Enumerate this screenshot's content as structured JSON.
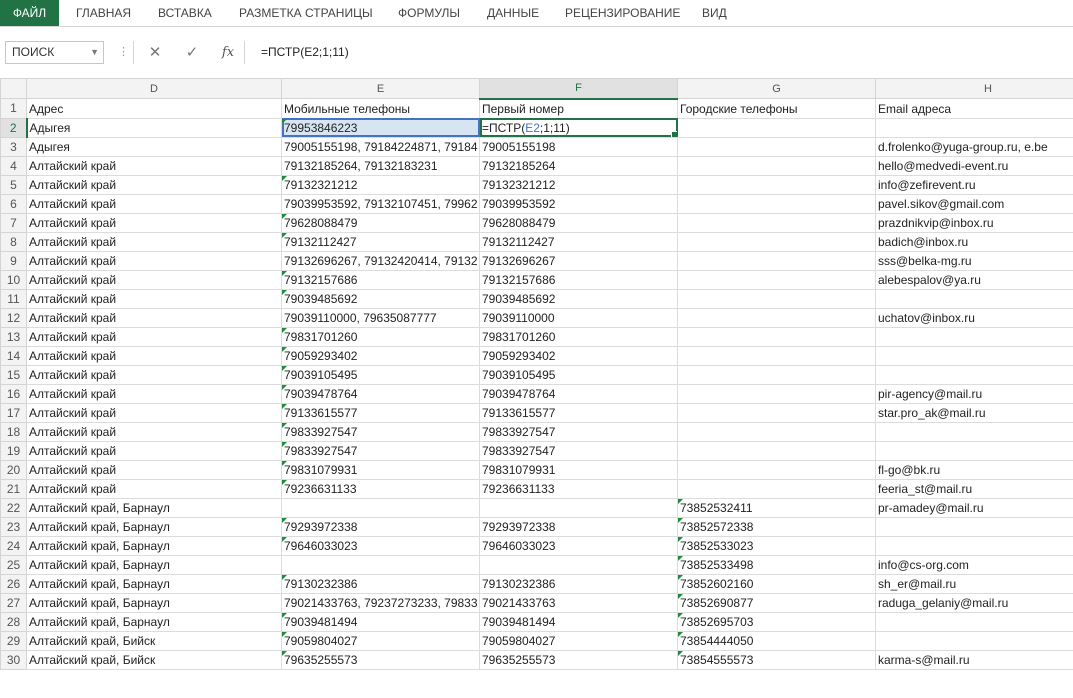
{
  "ribbon": {
    "tabs": [
      "ФАЙЛ",
      "ГЛАВНАЯ",
      "ВСТАВКА",
      "РАЗМЕТКА СТРАНИЦЫ",
      "ФОРМУЛЫ",
      "ДАННЫЕ",
      "РЕЦЕНЗИРОВАНИЕ",
      "ВИД"
    ]
  },
  "formula_bar": {
    "name_box": "ПОИСК",
    "cancel_icon": "✕",
    "enter_icon": "✓",
    "function_icon": "fx",
    "formula": "=ПСТР(E2;1;11)"
  },
  "grid": {
    "columns": [
      "D",
      "E",
      "F",
      "G",
      "H"
    ],
    "selected_column": "F",
    "selected_row": 2,
    "active_cell": {
      "prefix": "=ПСТР(",
      "ref": "E2",
      "suffix": ";1;11)"
    },
    "rows": [
      {
        "n": "1",
        "d": "Адрес",
        "e": "Мобильные телефоны",
        "f": "Первый номер",
        "g": "Городские телефоны",
        "h": "Email адреса"
      },
      {
        "n": "2",
        "d": "Адыгея",
        "e": "79953846223",
        "f": "",
        "g": "",
        "h": ""
      },
      {
        "n": "3",
        "d": "Адыгея",
        "e": "79005155198, 79184224871, 79184",
        "f": "79005155198",
        "g": "",
        "h": "d.frolenko@yuga-group.ru, e.be"
      },
      {
        "n": "4",
        "d": "Алтайский край",
        "e": "79132185264, 79132183231",
        "f": "79132185264",
        "g": "",
        "h": "hello@medvedi-event.ru"
      },
      {
        "n": "5",
        "d": "Алтайский край",
        "e": "79132321212",
        "f": "79132321212",
        "g": "",
        "h": "info@zefirevent.ru"
      },
      {
        "n": "6",
        "d": "Алтайский край",
        "e": "79039953592, 79132107451, 79962",
        "f": "79039953592",
        "g": "",
        "h": "pavel.sikov@gmail.com"
      },
      {
        "n": "7",
        "d": "Алтайский край",
        "e": "79628088479",
        "f": "79628088479",
        "g": "",
        "h": "prazdnikvip@inbox.ru"
      },
      {
        "n": "8",
        "d": "Алтайский край",
        "e": "79132112427",
        "f": "79132112427",
        "g": "",
        "h": "badich@inbox.ru"
      },
      {
        "n": "9",
        "d": "Алтайский край",
        "e": "79132696267, 79132420414, 79132",
        "f": "79132696267",
        "g": "",
        "h": "sss@belka-mg.ru"
      },
      {
        "n": "10",
        "d": "Алтайский край",
        "e": "79132157686",
        "f": "79132157686",
        "g": "",
        "h": "alebespalov@ya.ru"
      },
      {
        "n": "11",
        "d": "Алтайский край",
        "e": "79039485692",
        "f": "79039485692",
        "g": "",
        "h": ""
      },
      {
        "n": "12",
        "d": "Алтайский край",
        "e": "79039110000, 79635087777",
        "f": "79039110000",
        "g": "",
        "h": "uchatov@inbox.ru"
      },
      {
        "n": "13",
        "d": "Алтайский край",
        "e": "79831701260",
        "f": "79831701260",
        "g": "",
        "h": ""
      },
      {
        "n": "14",
        "d": "Алтайский край",
        "e": "79059293402",
        "f": "79059293402",
        "g": "",
        "h": ""
      },
      {
        "n": "15",
        "d": "Алтайский край",
        "e": "79039105495",
        "f": "79039105495",
        "g": "",
        "h": ""
      },
      {
        "n": "16",
        "d": "Алтайский край",
        "e": "79039478764",
        "f": "79039478764",
        "g": "",
        "h": "pir-agency@mail.ru"
      },
      {
        "n": "17",
        "d": "Алтайский край",
        "e": "79133615577",
        "f": "79133615577",
        "g": "",
        "h": "star.pro_ak@mail.ru"
      },
      {
        "n": "18",
        "d": "Алтайский край",
        "e": "79833927547",
        "f": "79833927547",
        "g": "",
        "h": ""
      },
      {
        "n": "19",
        "d": "Алтайский край",
        "e": "79833927547",
        "f": "79833927547",
        "g": "",
        "h": ""
      },
      {
        "n": "20",
        "d": "Алтайский край",
        "e": "79831079931",
        "f": "79831079931",
        "g": "",
        "h": "fl-go@bk.ru"
      },
      {
        "n": "21",
        "d": "Алтайский край",
        "e": "79236631133",
        "f": "79236631133",
        "g": "",
        "h": "feeria_st@mail.ru"
      },
      {
        "n": "22",
        "d": "Алтайский край, Барнаул",
        "e": "",
        "f": "",
        "g": "73852532411",
        "h": "pr-amadey@mail.ru"
      },
      {
        "n": "23",
        "d": "Алтайский край, Барнаул",
        "e": "79293972338",
        "f": "79293972338",
        "g": "73852572338",
        "h": ""
      },
      {
        "n": "24",
        "d": "Алтайский край, Барнаул",
        "e": "79646033023",
        "f": "79646033023",
        "g": "73852533023",
        "h": ""
      },
      {
        "n": "25",
        "d": "Алтайский край, Барнаул",
        "e": "",
        "f": "",
        "g": "73852533498",
        "h": "info@cs-org.com"
      },
      {
        "n": "26",
        "d": "Алтайский край, Барнаул",
        "e": "79130232386",
        "f": "79130232386",
        "g": "73852602160",
        "h": "sh_er@mail.ru"
      },
      {
        "n": "27",
        "d": "Алтайский край, Барнаул",
        "e": "79021433763, 79237273233, 79833",
        "f": "79021433763",
        "g": "73852690877",
        "h": "raduga_gelaniy@mail.ru"
      },
      {
        "n": "28",
        "d": "Алтайский край, Барнаул",
        "e": "79039481494",
        "f": "79039481494",
        "g": "73852695703",
        "h": ""
      },
      {
        "n": "29",
        "d": "Алтайский край, Бийск",
        "e": "79059804027",
        "f": "79059804027",
        "g": "73854444050",
        "h": ""
      },
      {
        "n": "30",
        "d": "Алтайский край, Бийск",
        "e": "79635255573",
        "f": "79635255573",
        "g": "73854555573",
        "h": "karma-s@mail.ru"
      }
    ]
  }
}
